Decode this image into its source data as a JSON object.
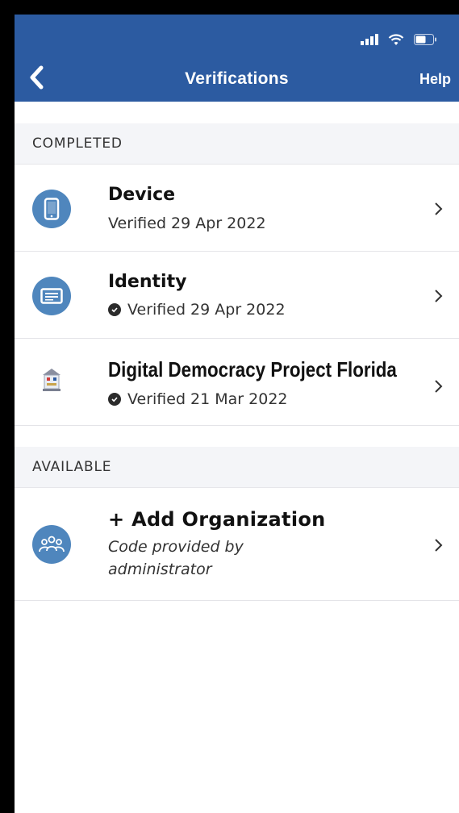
{
  "header": {
    "title": "Verifications",
    "help_label": "Help",
    "back_icon": "chevron-left-icon",
    "background_color": "#2c5ba1"
  },
  "status_bar": {
    "icons": [
      "signal-icon",
      "wifi-icon",
      "battery-icon"
    ]
  },
  "completed": {
    "header": "COMPLETED",
    "items": [
      {
        "title": "Device",
        "subtitle": "Verified 29 Apr 2022",
        "icon": "phone-icon"
      },
      {
        "title": "Identity",
        "subtitle": "Verified 29 Apr 2022",
        "icon": "id-card-icon"
      },
      {
        "title": "Digital Democracy Project Florida",
        "subtitle": "Verified 21 Mar 2022",
        "icon": "organization-logo-icon"
      }
    ]
  },
  "available": {
    "header": "AVAILABLE",
    "items": [
      {
        "title": "+ Add Organization",
        "subtitle": "Code provided by administrator",
        "icon": "group-icon"
      }
    ]
  },
  "colors": {
    "accent": "#2c5ba1",
    "icon_circle": "#4f86bd",
    "section_bg": "#f4f5f8"
  }
}
